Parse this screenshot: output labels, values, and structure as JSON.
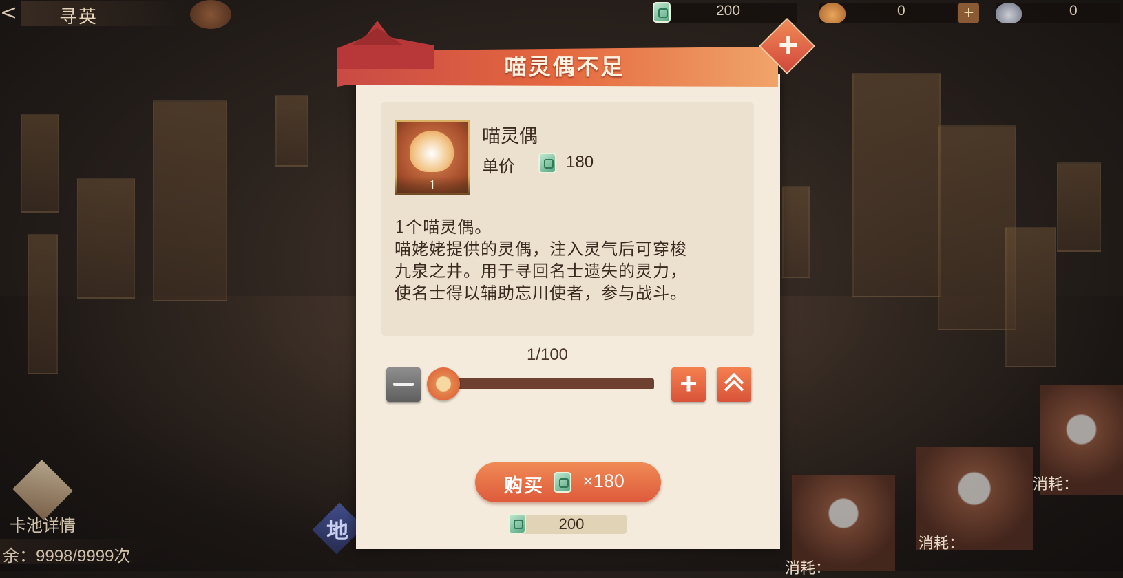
{
  "header": {
    "back_symbol": "<",
    "title": "寻英",
    "resources": [
      {
        "icon": "jade-icon",
        "value": "200"
      },
      {
        "icon": "cat-icon",
        "value": "0"
      },
      {
        "icon": "husky-icon",
        "value": "0"
      }
    ],
    "add_symbol": "+"
  },
  "dialog": {
    "title": "喵灵偶不足",
    "close_symbol": "+",
    "item": {
      "name": "喵灵偶",
      "count": "1",
      "price_label": "单价",
      "price": "180"
    },
    "description": [
      "1个喵灵偶。",
      "喵姥姥提供的灵偶，注入灵气后可穿梭",
      "九泉之井。用于寻回名士遗失的灵力，",
      "使名士得以辅助忘川使者，参与战斗。"
    ],
    "quantity": {
      "display": "1/100",
      "current": 1,
      "max": 100,
      "plus_symbol": "+"
    },
    "buy": {
      "label": "购买",
      "times_text": "×180"
    },
    "owned": "200"
  },
  "background": {
    "pool_details_label": "卡池详情",
    "remaining_label": "余：9998/9999次",
    "earth_badge": "地",
    "cost_labels": [
      "消耗：",
      "消耗：",
      "消耗："
    ]
  },
  "colors": {
    "accent_red": "#dd5a3b",
    "dialog_bg": "#f4ebdc",
    "jade": "#5aa784"
  }
}
